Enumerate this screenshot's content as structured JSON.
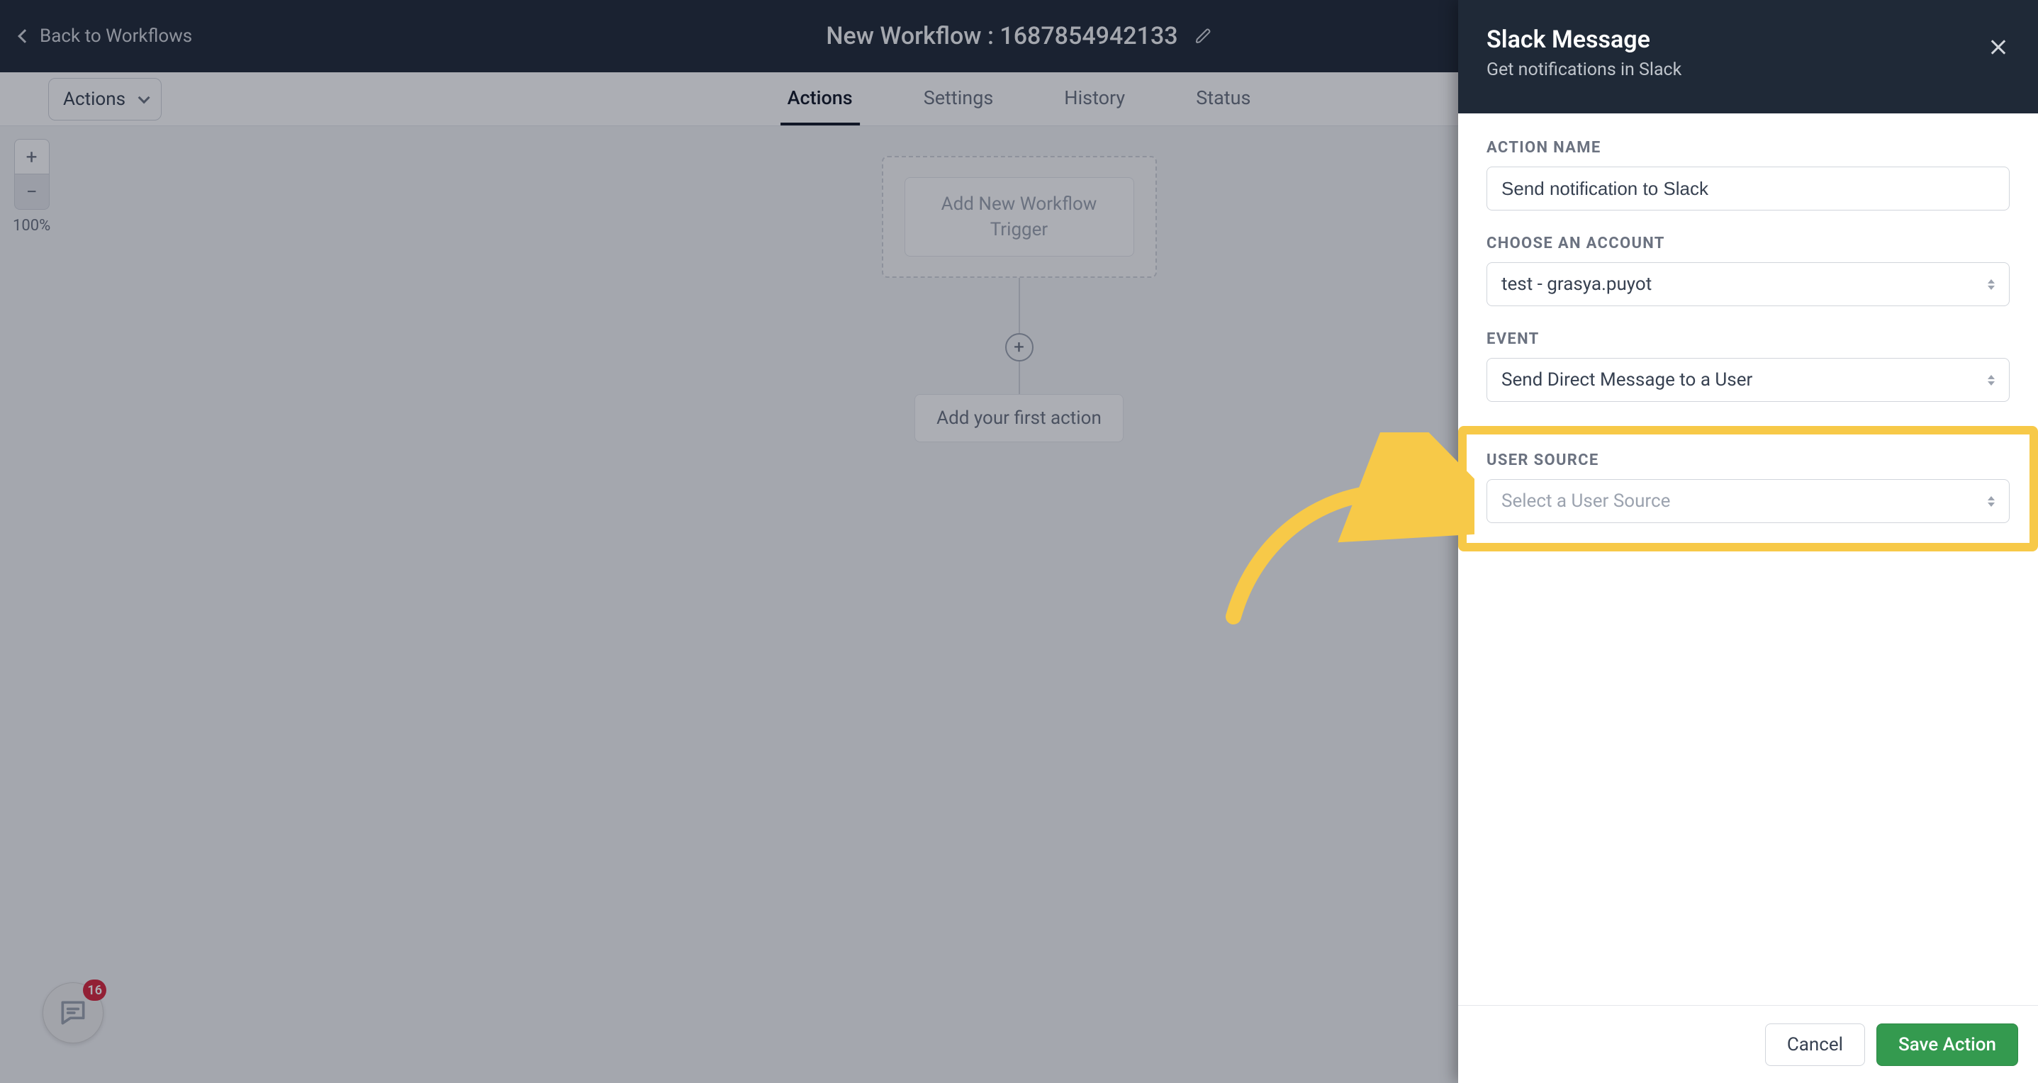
{
  "header": {
    "back_label": "Back to Workflows",
    "title": "New Workflow : 1687854942133"
  },
  "toolbar": {
    "actions_dropdown_label": "Actions"
  },
  "tabs": {
    "actions": "Actions",
    "settings": "Settings",
    "history": "History",
    "status": "Status"
  },
  "zoom": {
    "plus": "+",
    "minus": "−",
    "percent": "100%"
  },
  "canvas": {
    "trigger_placeholder": "Add New Workflow Trigger",
    "first_action_label": "Add your first action"
  },
  "chat": {
    "badge": "16"
  },
  "panel": {
    "title": "Slack Message",
    "subtitle": "Get notifications in Slack",
    "fields": {
      "action_name": {
        "label": "Action Name",
        "value": "Send notification to Slack"
      },
      "account": {
        "label": "Choose an Account",
        "value": "test - grasya.puyot"
      },
      "event": {
        "label": "Event",
        "value": "Send Direct Message to a User"
      },
      "user_source": {
        "label": "User Source",
        "placeholder": "Select a User Source"
      }
    },
    "footer": {
      "cancel": "Cancel",
      "save": "Save Action"
    }
  }
}
